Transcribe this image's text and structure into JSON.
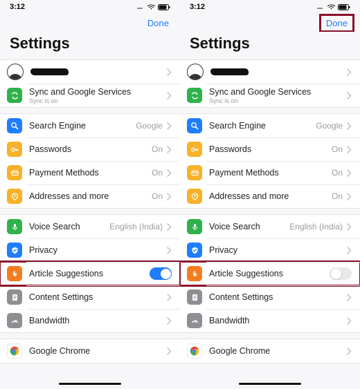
{
  "status": {
    "time": "3:12"
  },
  "topbar": {
    "done": "Done"
  },
  "page_title": "Settings",
  "rows": {
    "sync": {
      "label": "Sync and Google Services",
      "subtitle": "Sync is on"
    },
    "search_engine": {
      "label": "Search Engine",
      "value": "Google"
    },
    "passwords": {
      "label": "Passwords",
      "value": "On"
    },
    "payment": {
      "label": "Payment Methods",
      "value": "On"
    },
    "addresses": {
      "label": "Addresses and more",
      "value": "On"
    },
    "voice": {
      "label": "Voice Search",
      "value": "English (India)"
    },
    "privacy": {
      "label": "Privacy"
    },
    "article": {
      "label": "Article Suggestions"
    },
    "content": {
      "label": "Content Settings"
    },
    "bandwidth": {
      "label": "Bandwidth"
    },
    "chrome": {
      "label": "Google Chrome"
    }
  },
  "icons": {
    "sync_color": "#2fb24c",
    "search_color": "#1f7dff",
    "passwords_color": "#f7b22a",
    "payment_color": "#f7b22a",
    "addresses_color": "#f7b22a",
    "voice_color": "#2fb24c",
    "privacy_color": "#1f7dff",
    "article_color": "#f57d1f",
    "content_color": "#8e8e93",
    "bandwidth_color": "#8e8e93",
    "chrome_color": "#ffffff"
  },
  "highlights": {
    "left_article": true,
    "right_done": true,
    "right_article": true
  },
  "toggle": {
    "left_on": true,
    "right_on": false
  }
}
